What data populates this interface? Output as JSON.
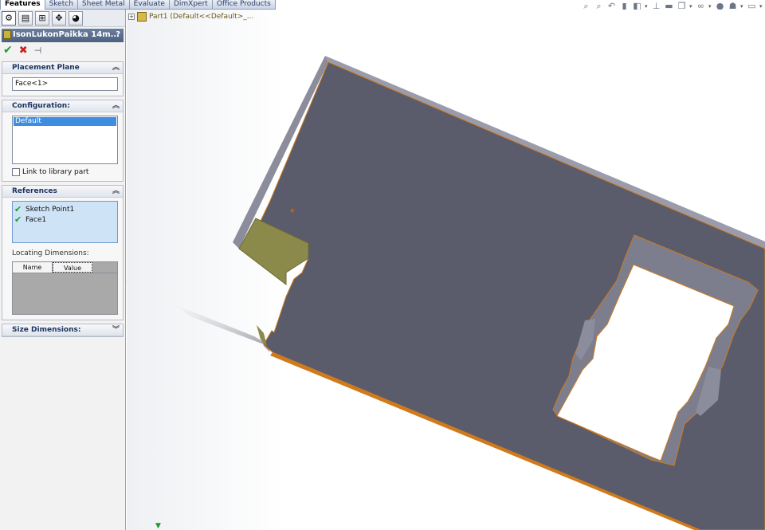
{
  "command_tabs": [
    "Features",
    "Sketch",
    "Sheet Metal",
    "Evaluate",
    "DimXpert",
    "Office Products"
  ],
  "active_tab": "Features",
  "property_manager": {
    "title": "IsonLukonPaikka 14m...",
    "help": "?",
    "placement_plane": {
      "header": "Placement Plane",
      "value": "Face<1>"
    },
    "configuration": {
      "header": "Configuration:",
      "items": [
        "Default"
      ],
      "selected": "Default",
      "link_label": "Link to library part"
    },
    "references": {
      "header": "References",
      "items": [
        "Sketch Point1",
        "Face1"
      ],
      "locating_label": "Locating Dimensions:",
      "columns": [
        "Name",
        "Value"
      ]
    },
    "size_dimensions": {
      "header": "Size Dimensions:"
    }
  },
  "graphics": {
    "tree_label": "Part1  (Default<<Default>_..."
  },
  "icons": {
    "ok": "check-icon",
    "cancel": "x-icon",
    "pin": "pushpin-icon",
    "collapse": "chevron-up-double-icon",
    "expand": "chevron-down-double-icon"
  },
  "colors": {
    "panel_title": "#5a6f8f",
    "face": "#5a5c6b",
    "edge_highlight": "#d07a1c",
    "side_wall": "#8b8d9c",
    "preview_yellow": "#8c8a4a"
  }
}
